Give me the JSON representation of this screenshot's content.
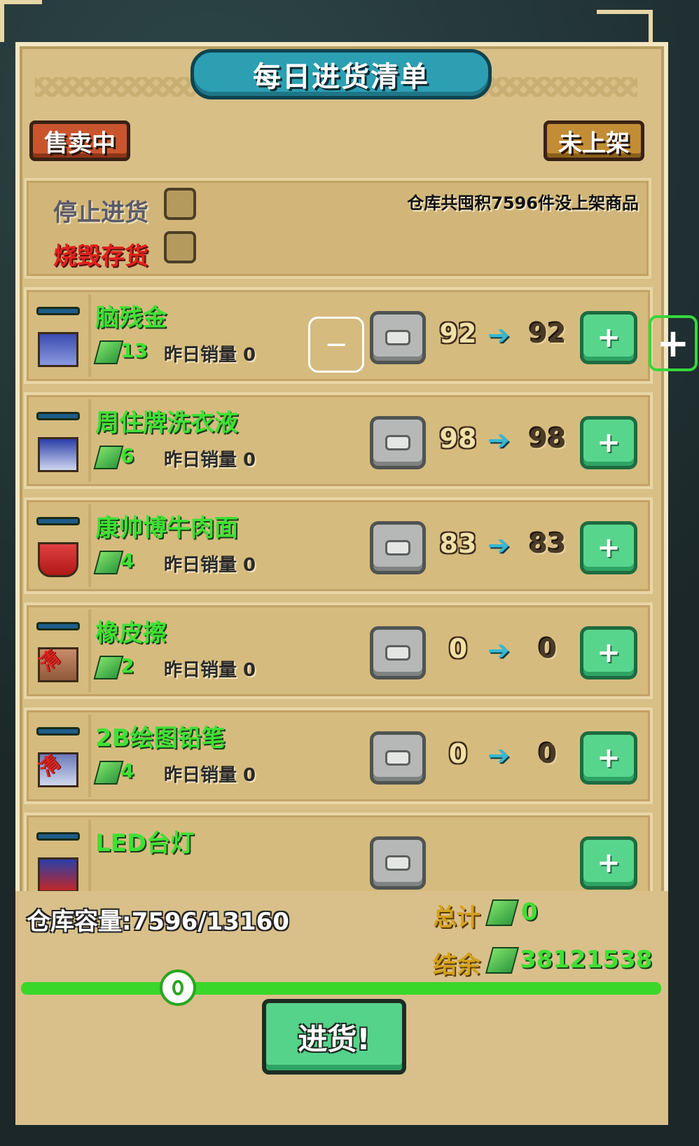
{
  "window_title": "每日进货清单",
  "tabs": {
    "selling": "售卖中",
    "unlisted": "未上架"
  },
  "options": {
    "stop_restock": "停止进货",
    "burn_stock": "烧毁存货",
    "stock_note": "仓库共囤积7596件没上架商品"
  },
  "items": [
    {
      "name": "脑残金",
      "price": "13",
      "sales": "昨日销量 0",
      "from": "92",
      "to": "92",
      "stamp": ""
    },
    {
      "name": "周住牌洗衣液",
      "price": "6",
      "sales": "昨日销量 0",
      "from": "98",
      "to": "98",
      "stamp": ""
    },
    {
      "name": "康帅博牛肉面",
      "price": "4",
      "sales": "昨日销量 0",
      "from": "83",
      "to": "83",
      "stamp": ""
    },
    {
      "name": "橡皮擦",
      "price": "2",
      "sales": "昨日销量 0",
      "from": "0",
      "to": "0",
      "stamp": "清"
    },
    {
      "name": "2B绘图铅笔",
      "price": "4",
      "sales": "昨日销量 0",
      "from": "0",
      "to": "0",
      "stamp": "清"
    },
    {
      "name": "LED台灯",
      "price": "",
      "sales": "",
      "from": "",
      "to": "",
      "stamp": ""
    }
  ],
  "arrow_symbol": "➔",
  "minus_symbol": "−",
  "plus_symbol": "+",
  "footer": {
    "capacity": "仓库容量:7596/13160",
    "total_label": "总计",
    "total_value": "0",
    "balance_label": "结余",
    "balance_value": "38121538",
    "slider_value": 0,
    "purchase_button": "进货!"
  },
  "colors": {
    "accent_green": "#3fe035",
    "title_blue": "#2c9fb3",
    "alert_red": "#e0231c",
    "panel_tan": "#d8bf86"
  }
}
